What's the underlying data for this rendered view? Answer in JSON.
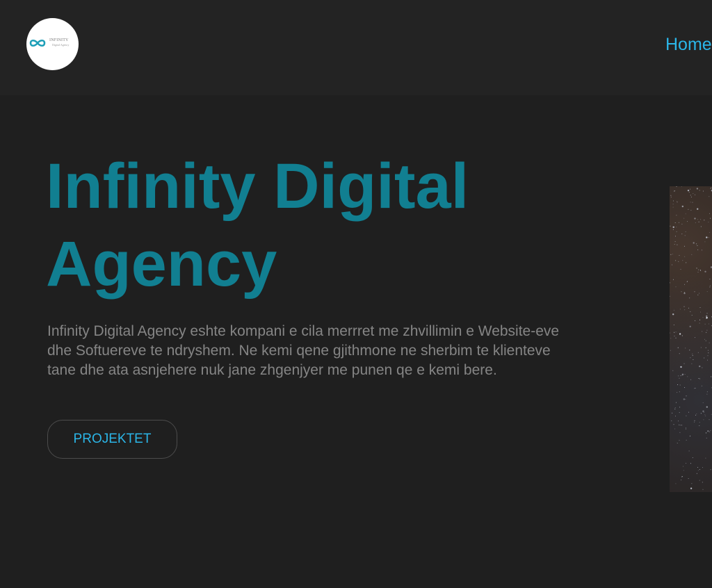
{
  "header": {
    "logo": {
      "icon": "infinity-icon",
      "brand_text": "INFINITY",
      "brand_subtext": "Digital Agency"
    },
    "nav": {
      "home_label": "Home"
    }
  },
  "hero": {
    "title_line1": "Infinity Digital",
    "title_line2": "Agency",
    "description": "Infinity Digital Agency eshte kompani e cila merrret me zhvillimin e Website-eve dhe Softuereve te ndryshem. Ne kemi qene gjithmone ne sherbim te klienteve tane dhe ata asnjehere nuk jane zhgenjyer me punen qe e kemi bere.",
    "cta_label": "PROJEKTET",
    "image": "starfield-image"
  },
  "colors": {
    "background": "#1f1f1f",
    "header_background": "#232323",
    "accent": "#2bb6e8",
    "title": "#117f91",
    "body_text": "#858585"
  }
}
